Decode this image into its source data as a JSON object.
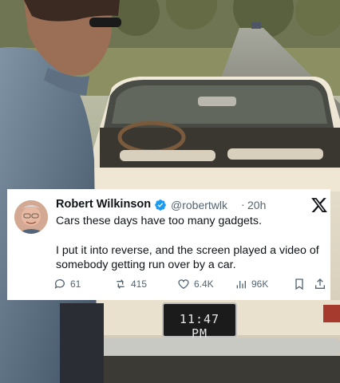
{
  "post": {
    "author_name": "Robert Wilkinson",
    "handle": "@robertwlk",
    "separator": "·",
    "time": "20h",
    "text_line1": "Cars these days have too many gadgets.",
    "text_line2": "I put it into reverse, and the screen played a video of somebody getting run over by a car.",
    "metrics": {
      "replies": "61",
      "reposts": "415",
      "likes": "6.4K",
      "views": "96K"
    }
  },
  "scene": {
    "license_plate": "11:47 PM"
  },
  "icons": [
    "verified-badge-icon",
    "x-logo-icon",
    "reply-icon",
    "repost-icon",
    "like-icon",
    "views-icon",
    "bookmark-icon",
    "share-icon"
  ],
  "colors": {
    "verified_blue": "#1d9bf0",
    "text": "#0f1419",
    "muted": "#536471"
  }
}
